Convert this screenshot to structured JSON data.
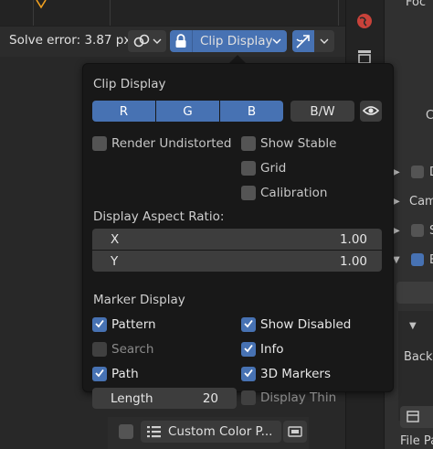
{
  "header": {
    "solve_error": "Solve error: 3.87 px",
    "clip_display_label": "Clip Display"
  },
  "popover": {
    "title": "Clip Display",
    "channels": {
      "r": "R",
      "g": "G",
      "b": "B"
    },
    "bw_label": "B/W",
    "render_undistorted": {
      "label": "Render Undistorted",
      "checked": false
    },
    "show_stable": {
      "label": "Show Stable",
      "checked": false
    },
    "grid": {
      "label": "Grid",
      "checked": false
    },
    "calibration": {
      "label": "Calibration",
      "checked": false
    },
    "aspect_title": "Display Aspect Ratio:",
    "aspect_x": {
      "label": "X",
      "value": "1.00"
    },
    "aspect_y": {
      "label": "Y",
      "value": "1.00"
    },
    "marker_title": "Marker Display",
    "pattern": {
      "label": "Pattern",
      "checked": true
    },
    "show_disabled": {
      "label": "Show Disabled",
      "checked": true
    },
    "search": {
      "label": "Search",
      "checked": false
    },
    "info": {
      "label": "Info",
      "checked": true
    },
    "path": {
      "label": "Path",
      "checked": true
    },
    "markers_3d": {
      "label": "3D Markers",
      "checked": true
    },
    "length": {
      "label": "Length",
      "value": "20"
    },
    "display_thin": {
      "label": "Display Thin",
      "checked": false
    }
  },
  "bottom": {
    "custom_color_label": "Custom Color P..."
  },
  "properties": {
    "row_d": "D",
    "row_cam": "Cam",
    "row_s": "S",
    "row_b": "B",
    "label_back": "Back",
    "label_c": "C",
    "label_foc": "Foc",
    "label_file_pa": "File Pa"
  },
  "colors": {
    "accent": "#4772b3",
    "popover_bg": "#181818",
    "field_bg": "#3d3d3d"
  }
}
